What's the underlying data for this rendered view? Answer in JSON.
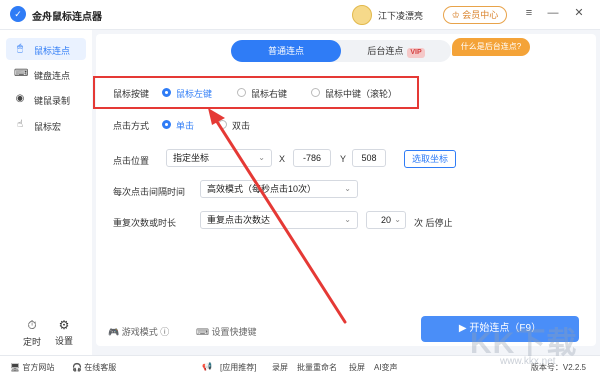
{
  "app": {
    "title": "金舟鼠标连点器",
    "logo_glyph": "✓"
  },
  "user": {
    "name": "江下凌漂亮"
  },
  "header": {
    "member_button": "会员中心",
    "member_icon": "crown-icon"
  },
  "window": {
    "menu_glyph": "≡",
    "minimize_glyph": "—",
    "close_glyph": "✕"
  },
  "sidebar": {
    "items": [
      {
        "label": "鼠标连点",
        "icon": "mouse-icon",
        "glyph": "🖱",
        "active": true
      },
      {
        "label": "键盘连点",
        "icon": "keyboard-icon",
        "glyph": "⌨",
        "active": false
      },
      {
        "label": "键鼠录制",
        "icon": "record-icon",
        "glyph": "◉",
        "active": false
      },
      {
        "label": "鼠标宏",
        "icon": "hand-icon",
        "glyph": "☝",
        "active": false
      }
    ],
    "bottom": [
      {
        "label": "定时",
        "icon": "timer-icon",
        "glyph": "⏱"
      },
      {
        "label": "设置",
        "icon": "settings-icon",
        "glyph": "⚙"
      }
    ]
  },
  "tabs": {
    "normal": "普通连点",
    "background": "后台连点",
    "vip_tag": "VIP",
    "what_background": "什么是后台连点?"
  },
  "form": {
    "mouse_button": {
      "label": "鼠标按键",
      "options": [
        "鼠标左键",
        "鼠标右键",
        "鼠标中键（滚轮）"
      ],
      "selected": 0
    },
    "click_mode": {
      "label": "点击方式",
      "options": [
        "单击",
        "双击"
      ],
      "selected": 0
    },
    "click_position": {
      "label": "点击位置",
      "select_value": "指定坐标",
      "x_label": "X",
      "x_value": "-786",
      "y_label": "Y",
      "y_value": "508",
      "pick_button": "选取坐标"
    },
    "interval": {
      "label": "每次点击间隔时间",
      "select_value": "高效模式（每秒点击10次）"
    },
    "repeat": {
      "label": "重复次数或时长",
      "select_value": "重复点击次数达",
      "count_value": "20",
      "suffix": "次 后停止"
    }
  },
  "footer": {
    "game_mode": "游戏模式",
    "shortcut": "设置快捷键",
    "start_button": "开始连点（F9）"
  },
  "bottombar": {
    "official_site": "官方网站",
    "online_service": "在线客服",
    "app_recommend": "[应用推荐]",
    "links": [
      "录屏",
      "批量重命名",
      "投屏",
      "AI变声"
    ],
    "version": "版本号：V2.2.5"
  },
  "watermark": {
    "big": "KK下载",
    "small": "www.kkx.net"
  },
  "colors": {
    "accent": "#2f7cf6",
    "annotation": "#e53935",
    "member": "#e8a34a"
  }
}
